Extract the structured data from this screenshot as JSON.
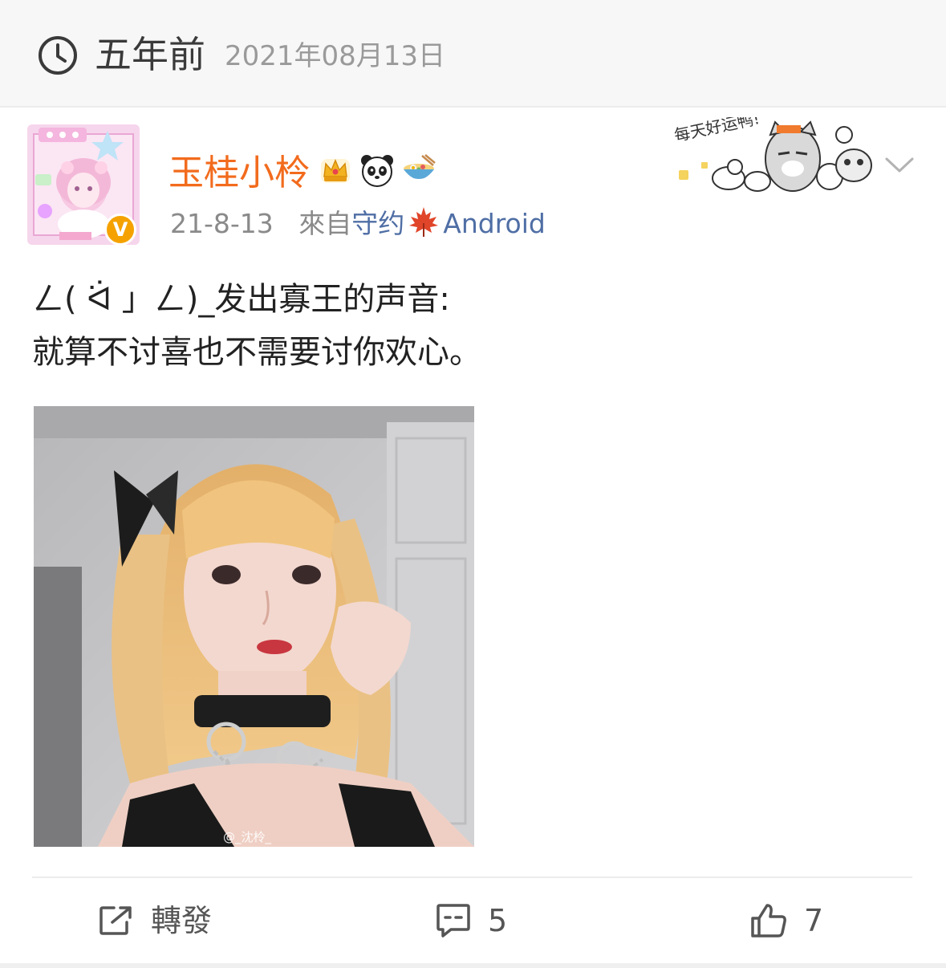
{
  "memory": {
    "ago": "五年前",
    "date": "2021年08月13日"
  },
  "post": {
    "username": "玉桂小柃",
    "badges": [
      "crown-icon",
      "panda-icon",
      "noodle-bowl-icon"
    ],
    "time": "21-8-13",
    "source_prefix": "來自",
    "source_name": "守约",
    "source_device": "Android",
    "verified_mark": "V",
    "text_lines": [
      "ㄥ( ᐛ 」ㄥ)_发出寡王的声音:",
      "就算不讨喜也不需要讨你欢心。"
    ],
    "photo_watermark": "@_沈柃_",
    "sticker_text": "每天好运鸭!"
  },
  "actions": {
    "repost_label": "轉發",
    "comment_count": "5",
    "like_count": "7"
  },
  "colors": {
    "username": "#f26b1d",
    "source": "#4f6ea5",
    "verified": "#f5a200"
  }
}
